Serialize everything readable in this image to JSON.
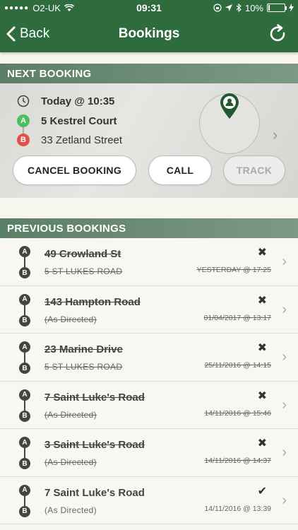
{
  "status_bar": {
    "carrier": "O2-UK",
    "time": "09:31",
    "battery": "10%",
    "battery_level": 0.1
  },
  "nav": {
    "back_label": "Back",
    "title": "Bookings"
  },
  "next_booking": {
    "header": "NEXT BOOKING",
    "time": "Today @ 10:35",
    "pin_a": "A",
    "pin_b": "B",
    "from": "5 Kestrel Court",
    "to": "33 Zetland Street",
    "cancel_label": "CANCEL BOOKING",
    "call_label": "CALL",
    "track_label": "TRACK"
  },
  "previous": {
    "header": "PREVIOUS BOOKINGS",
    "items": [
      {
        "from": "49 Crowland St",
        "to": "5 ST LUKES ROAD",
        "date": "YESTERDAY @ 17:25",
        "status": "✖",
        "cancelled": true
      },
      {
        "from": "143 Hampton Road",
        "to": "(As Directed)",
        "date": "01/04/2017 @ 13:17",
        "status": "✖",
        "cancelled": true
      },
      {
        "from": "23 Marine Drive",
        "to": "5 ST LUKES ROAD",
        "date": "25/11/2016 @ 14:15",
        "status": "✖",
        "cancelled": true
      },
      {
        "from": "7 Saint Luke's Road",
        "to": "(As Directed)",
        "date": "14/11/2016 @ 15:46",
        "status": "✖",
        "cancelled": true
      },
      {
        "from": "3 Saint Luke's Road",
        "to": "(As Directed)",
        "date": "14/11/2016 @ 14:37",
        "status": "✖",
        "cancelled": true
      },
      {
        "from": "7 Saint Luke's Road",
        "to": "(As Directed)",
        "date": "14/11/2016 @ 13:39",
        "status": "✔",
        "cancelled": false
      }
    ]
  }
}
